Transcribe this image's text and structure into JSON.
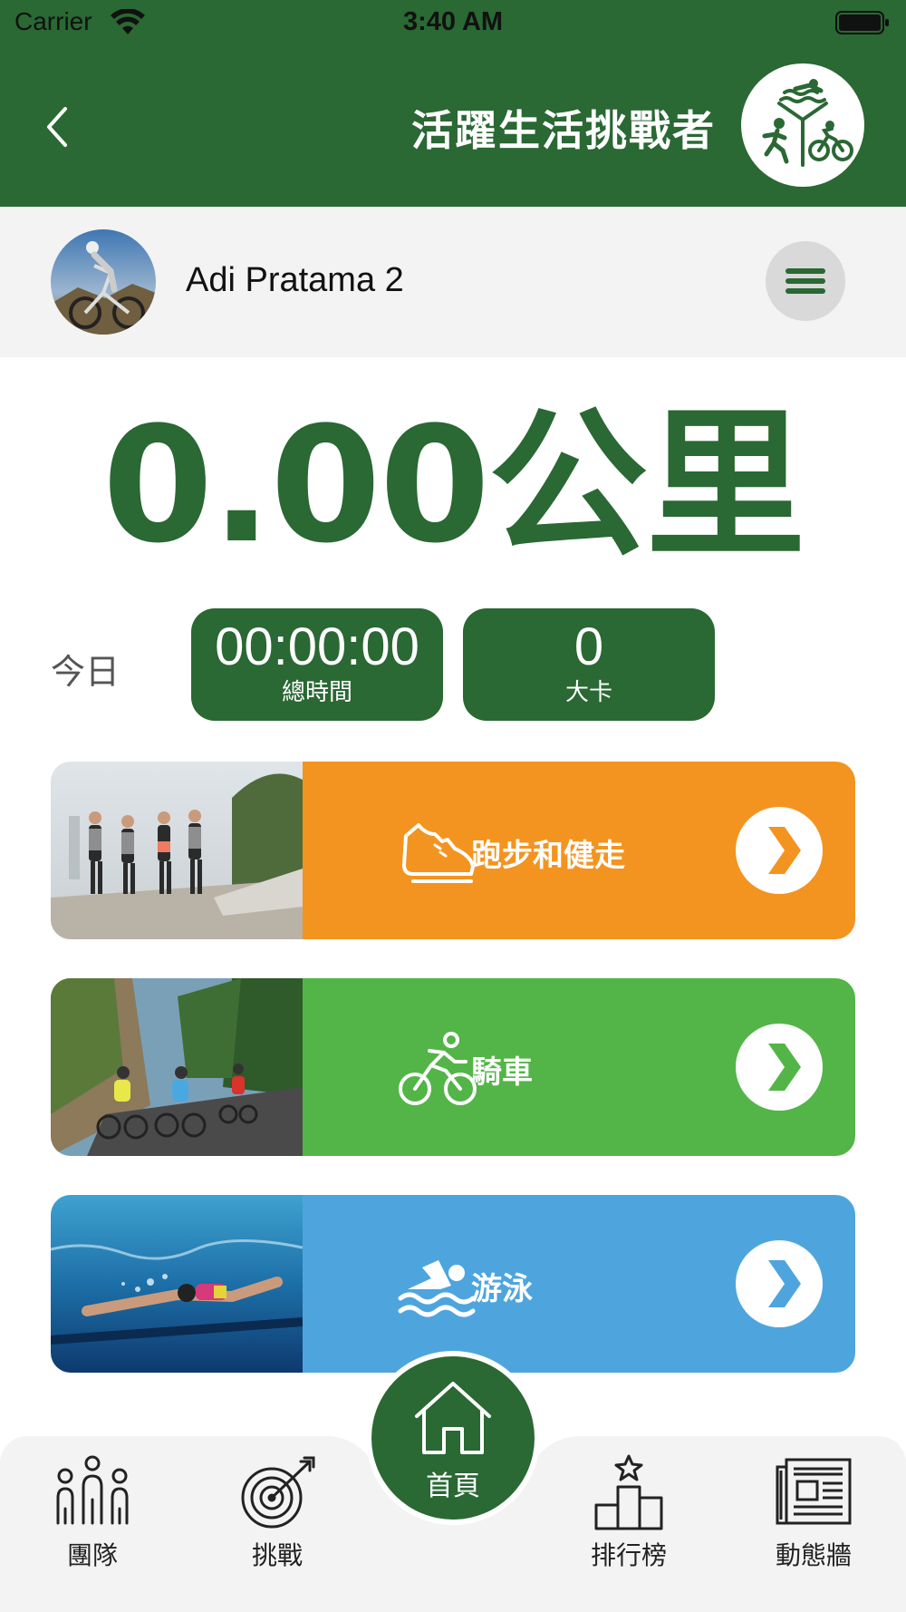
{
  "status_bar": {
    "carrier": "Carrier",
    "time": "3:40 AM"
  },
  "header": {
    "title": "活躍生活挑戰者"
  },
  "user": {
    "name": "Adi Pratama 2"
  },
  "distance": {
    "value": "0.00",
    "unit": "公里"
  },
  "today": {
    "label": "今日",
    "total_time": {
      "value": "00:00:00",
      "label": "總時間"
    },
    "calories": {
      "value": "0",
      "label": "大卡"
    }
  },
  "activities": [
    {
      "label": "跑步和健走",
      "icon": "running-shoe-icon",
      "color": "#f39420"
    },
    {
      "label": "騎車",
      "icon": "cyclist-icon",
      "color": "#53b547"
    },
    {
      "label": "游泳",
      "icon": "swimmer-icon",
      "color": "#4ea5de"
    }
  ],
  "bottom_nav": {
    "team": "團隊",
    "challenge": "挑戰",
    "home": "首頁",
    "leaderboard": "排行榜",
    "news_feed": "動態牆"
  },
  "colors": {
    "primary": "#2a6834",
    "light_bg": "#f3f3f3"
  }
}
